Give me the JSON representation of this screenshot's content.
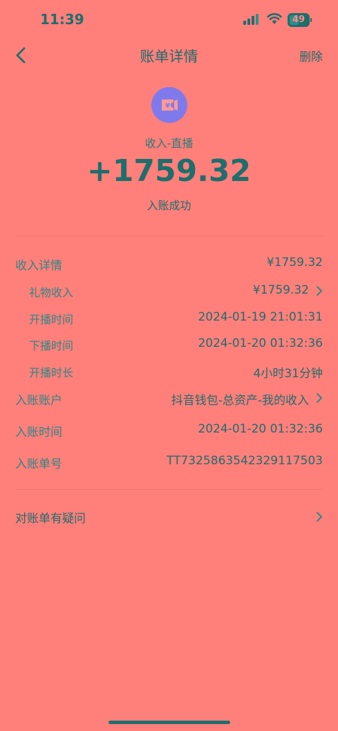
{
  "status_bar": {
    "time": "11:39",
    "battery": "49",
    "battery_level": 0.49
  },
  "nav": {
    "title": "账单详情",
    "delete_label": "删除"
  },
  "header": {
    "category_icon": "yuan-ticket-icon",
    "category_label": "收入-直播",
    "amount": "+1759.32",
    "status": "入账成功"
  },
  "details": {
    "income": {
      "label": "收入详情",
      "value": "¥1759.32"
    },
    "gift": {
      "label": "礼物收入",
      "value": "¥1759.32"
    },
    "start": {
      "label": "开播时间",
      "value": "2024-01-19 21:01:31"
    },
    "end": {
      "label": "下播时间",
      "value": "2024-01-20 01:32:36"
    },
    "duration": {
      "label": "开播时长",
      "value": "4小时31分钟"
    },
    "account": {
      "label": "入账账户",
      "value": "抖音钱包-总资产-我的收入"
    },
    "time": {
      "label": "入账时间",
      "value": "2024-01-20 01:32:36"
    },
    "order": {
      "label": "入账单号",
      "value": "TT7325863542329117503"
    }
  },
  "question_label": "对账单有疑问",
  "colors": {
    "background": "#FF7F7B",
    "text": "#1E6E6C",
    "icon_bg": "#7F7AEB"
  }
}
